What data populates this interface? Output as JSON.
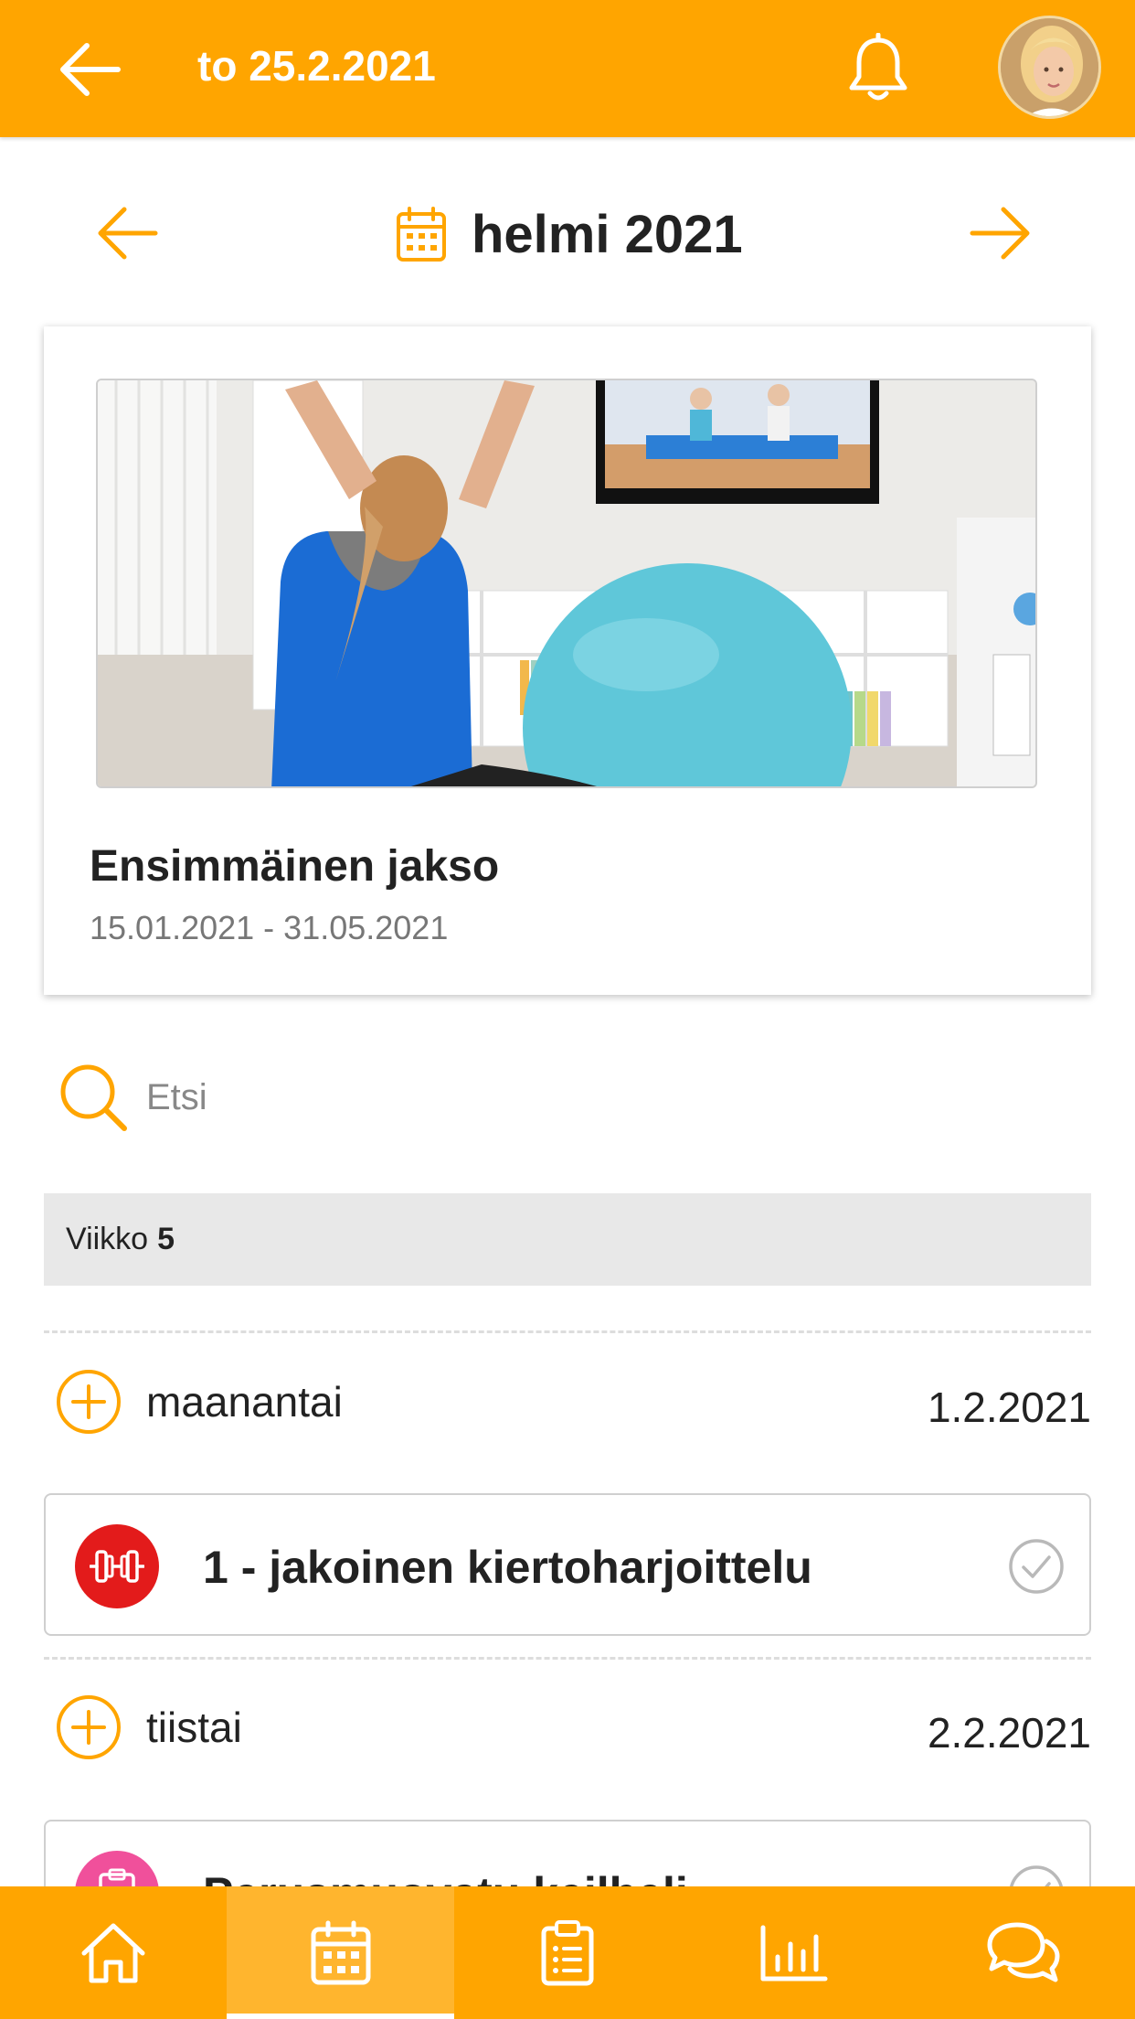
{
  "header": {
    "title": "to 25.2.2021",
    "back_icon": "arrow-left-icon",
    "notifications_icon": "bell-icon",
    "avatar": "user-avatar"
  },
  "month_nav": {
    "label": "helmi 2021",
    "prev_icon": "arrow-left-icon",
    "next_icon": "arrow-right-icon",
    "calendar_icon": "calendar-icon"
  },
  "program_card": {
    "title": "Ensimmäinen jakso",
    "dates": "15.01.2021 - 31.05.2021",
    "image": "woman-with-exercise-ball-watching-tv-photo"
  },
  "search": {
    "placeholder": "Etsi",
    "value": ""
  },
  "week": {
    "prefix": "Viikko",
    "number": "5"
  },
  "days": [
    {
      "name": "maanantai",
      "date": "1.2.2021",
      "event": {
        "title": "1 - jakoinen kiertoharjoittelu",
        "icon": "dumbbell-icon",
        "color": "#E31B1B"
      }
    },
    {
      "name": "tiistai",
      "date": "2.2.2021",
      "event": {
        "title": "Perusmuovatu keilbeli",
        "icon": "clipboard-icon",
        "color": "#F0509B"
      }
    }
  ],
  "bottom_nav": [
    {
      "name": "home",
      "icon": "home-icon",
      "active": false
    },
    {
      "name": "calendar",
      "icon": "calendar-icon",
      "active": true
    },
    {
      "name": "tasks",
      "icon": "clipboard-list-icon",
      "active": false
    },
    {
      "name": "stats",
      "icon": "bar-chart-icon",
      "active": false
    },
    {
      "name": "chat",
      "icon": "chat-icon",
      "active": false
    }
  ],
  "colors": {
    "accent": "#FFA500",
    "accent_active": "#FFB52E",
    "event_red": "#E31B1B",
    "event_pink": "#F0509B"
  }
}
